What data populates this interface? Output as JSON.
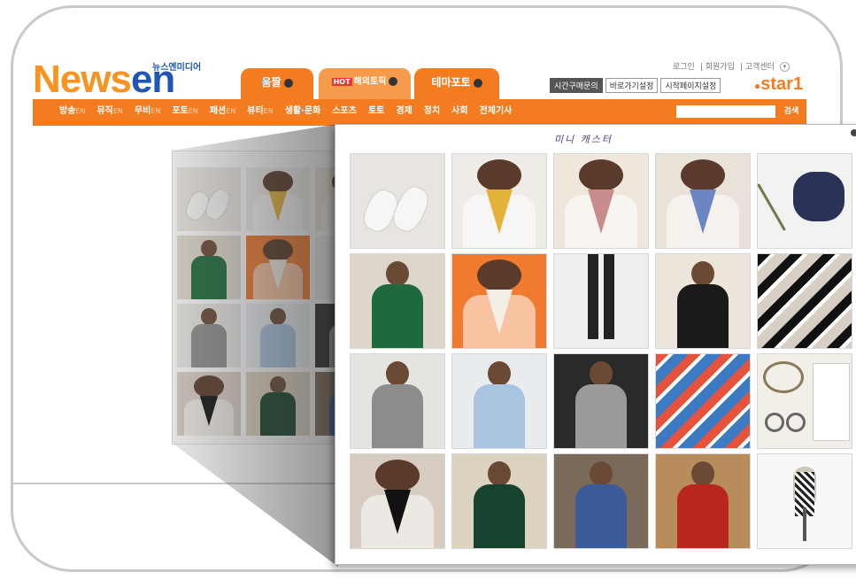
{
  "header": {
    "logo_part1": "News",
    "logo_part2": "en",
    "logo_sub": "뉴스엔미디어",
    "tabs": [
      {
        "label": "움짤",
        "hot": ""
      },
      {
        "label": "해외토픽",
        "hot": "HOT"
      },
      {
        "label": "테마포토",
        "hot": ""
      }
    ],
    "top_links": [
      "로그인",
      "회원가입",
      "고객센터"
    ],
    "buttons": [
      "시간구매문의",
      "바로가기설정",
      "시작페이지설정"
    ],
    "star_brand": "star1"
  },
  "nav": {
    "items": [
      {
        "label": "방송",
        "suffix": "EN"
      },
      {
        "label": "뮤직",
        "suffix": "EN"
      },
      {
        "label": "무비",
        "suffix": "EN"
      },
      {
        "label": "포토",
        "suffix": "EN"
      },
      {
        "label": "패션",
        "suffix": "EN"
      },
      {
        "label": "뷰티",
        "suffix": "EN"
      },
      {
        "label": "생활·문화",
        "suffix": ""
      },
      {
        "label": "스포츠",
        "suffix": ""
      },
      {
        "label": "토토",
        "suffix": ""
      },
      {
        "label": "경제",
        "suffix": ""
      },
      {
        "label": "정치",
        "suffix": ""
      },
      {
        "label": "사회",
        "suffix": ""
      },
      {
        "label": "전체기사",
        "suffix": ""
      }
    ],
    "search_placeholder": "",
    "search_button": "검색"
  },
  "popup": {
    "title": "미니 캐스터"
  },
  "gallery": {
    "tiles": [
      {
        "bg": "#e8e4df",
        "fg": "#f6f6f4",
        "kind": "shoes"
      },
      {
        "bg": "#efece8",
        "fg": "#e4b43a",
        "kind": "scarf"
      },
      {
        "bg": "#efe6dc",
        "fg": "#c98c8c",
        "kind": "scarf"
      },
      {
        "bg": "#e9e2d8",
        "fg": "#6c86c4",
        "kind": "scarf"
      },
      {
        "bg": "#f2f2f0",
        "fg": "#2a3258",
        "kind": "fabric"
      },
      {
        "bg": "#dcd6cc",
        "fg": "#1e6a3c",
        "kind": "person"
      },
      {
        "bg": "#f07a2e",
        "fg": "#f3efe6",
        "kind": "scarf"
      },
      {
        "bg": "#eeeeee",
        "fg": "#222222",
        "kind": "legs"
      },
      {
        "bg": "#ece5dc",
        "fg": "#1a1a1a",
        "kind": "person"
      },
      {
        "bg": "#d8cfc4",
        "fg": "#111111",
        "kind": "stripes"
      },
      {
        "bg": "#e6e4e0",
        "fg": "#8c8c8c",
        "kind": "person"
      },
      {
        "bg": "#e8ecef",
        "fg": "#a9c4e0",
        "kind": "person"
      },
      {
        "bg": "#2a2a2a",
        "fg": "#9a9a9a",
        "kind": "person"
      },
      {
        "bg": "#3c7bc4",
        "fg": "#e5533c",
        "kind": "stripes"
      },
      {
        "bg": "#f2efe8",
        "fg": "#8a7a5a",
        "kind": "jewelry"
      },
      {
        "bg": "#d6ccc2",
        "fg": "#111111",
        "kind": "scarf"
      },
      {
        "bg": "#dcd2c0",
        "fg": "#17432e",
        "kind": "person"
      },
      {
        "bg": "#7a6a5a",
        "fg": "#3a5a9a",
        "kind": "dress"
      },
      {
        "bg": "#b98c5c",
        "fg": "#b8261e",
        "kind": "dress"
      },
      {
        "bg": "#f7f7f7",
        "fg": "#888888",
        "kind": "mannequin"
      }
    ]
  }
}
